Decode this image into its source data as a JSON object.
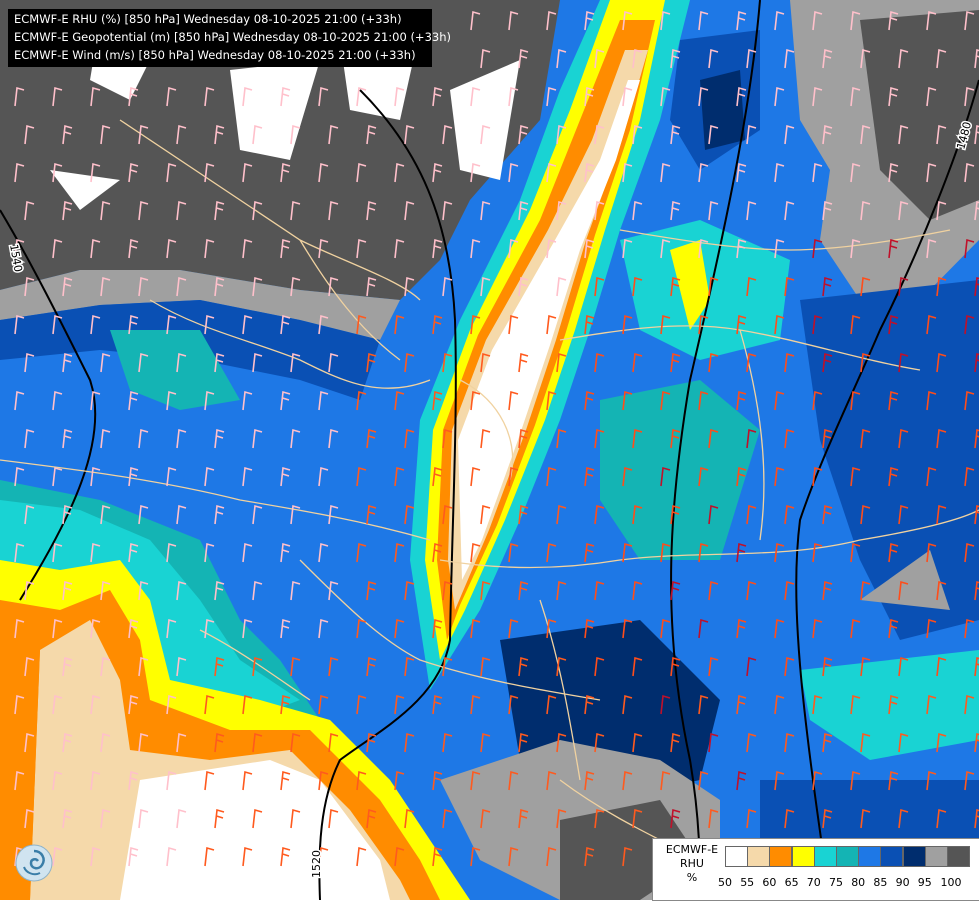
{
  "titles": [
    "ECMWF-E RHU (%) [850 hPa] Wednesday 08-10-2025 21:00 (+33h)",
    "ECMWF-E Geopotential (m) [850 hPa] Wednesday 08-10-2025 21:00 (+33h)",
    "ECMWF-E Wind (m/s) [850 hPa] Wednesday 08-10-2025 21:00 (+33h)"
  ],
  "contours": {
    "left": "1540",
    "top_right": "1480",
    "bottom": "1520"
  },
  "legend": {
    "model": "ECMWF-E",
    "variable": "RHU",
    "unit": "%",
    "ticks": [
      "50",
      "55",
      "60",
      "65",
      "70",
      "75",
      "80",
      "85",
      "90",
      "95",
      "100"
    ],
    "colors": [
      "#ffffff",
      "#f5d9aa",
      "#ff8c00",
      "#ffff00",
      "#19d3d3",
      "#14b4b4",
      "#1e78e6",
      "#0a50b4",
      "#002d6e",
      "#a0a0a0",
      "#555555"
    ]
  }
}
